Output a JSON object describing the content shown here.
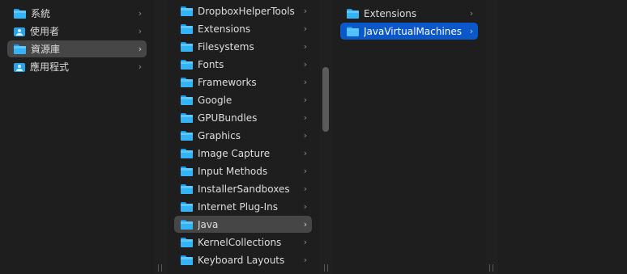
{
  "columns": {
    "favorites": [
      {
        "label": "系統",
        "icon": "folder-icon",
        "state": "none"
      },
      {
        "label": "使用者",
        "icon": "users-folder-icon",
        "state": "none"
      },
      {
        "label": "資源庫",
        "icon": "folder-icon",
        "state": "selected-inactive"
      },
      {
        "label": "應用程式",
        "icon": "applications-folder-icon",
        "state": "none"
      }
    ],
    "library": [
      {
        "label": "DropboxHelperTools",
        "state": "none"
      },
      {
        "label": "Extensions",
        "state": "none"
      },
      {
        "label": "Filesystems",
        "state": "none"
      },
      {
        "label": "Fonts",
        "state": "none"
      },
      {
        "label": "Frameworks",
        "state": "none"
      },
      {
        "label": "Google",
        "state": "none"
      },
      {
        "label": "GPUBundles",
        "state": "none"
      },
      {
        "label": "Graphics",
        "state": "none"
      },
      {
        "label": "Image Capture",
        "state": "none"
      },
      {
        "label": "Input Methods",
        "state": "none"
      },
      {
        "label": "InstallerSandboxes",
        "state": "none"
      },
      {
        "label": "Internet Plug-Ins",
        "state": "none"
      },
      {
        "label": "Java",
        "state": "selected-inactive"
      },
      {
        "label": "KernelCollections",
        "state": "none"
      },
      {
        "label": "Keyboard Layouts",
        "state": "none"
      }
    ],
    "java": [
      {
        "label": "Extensions",
        "state": "none"
      },
      {
        "label": "JavaVirtualMachines",
        "state": "selected-active"
      }
    ]
  },
  "chevron_glyph": "›",
  "column_handle_glyph": "||",
  "colors": {
    "background": "#1e1e1e",
    "selection_active": "#0a58ca",
    "selection_inactive": "#464646",
    "folder_blue": "#34b4f7"
  }
}
